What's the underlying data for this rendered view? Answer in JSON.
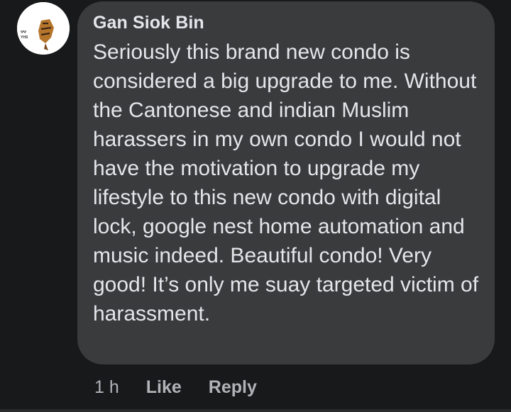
{
  "comment": {
    "author": "Gan Siok Bin",
    "text": "Seriously this brand new condo is considered a big upgrade to me. Without the Cantonese and indian Muslim harassers in my own condo I would not have the motivation to upgrade my lifestyle to this new condo with digital lock, google nest home automation and music indeed. Beautiful condo! Very good! It’s only me suay targeted victim of harassment.",
    "time": "1 h",
    "like_label": "Like",
    "reply_label": "Reply"
  },
  "colors": {
    "background": "#18191a",
    "bubble": "#3a3b3c",
    "text_primary": "#e4e6eb",
    "text_secondary": "#b0b3b8"
  }
}
